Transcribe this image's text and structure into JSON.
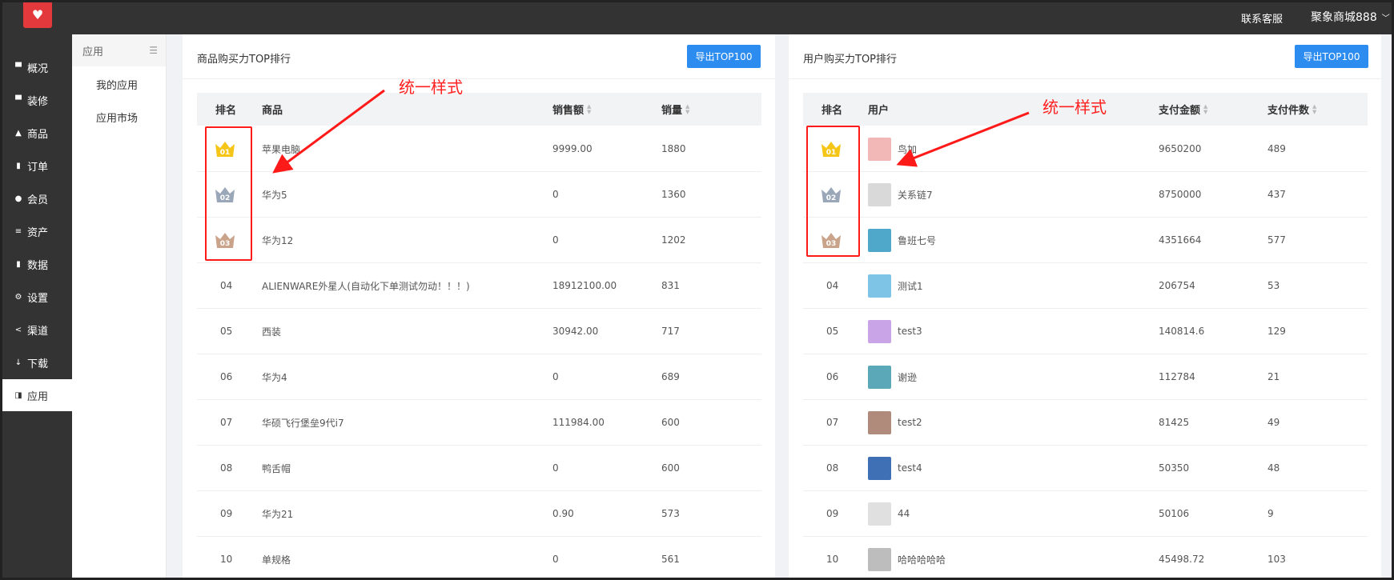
{
  "topbar": {
    "service": "联系客服",
    "shop": "聚象商城888"
  },
  "sidebar": {
    "items": [
      {
        "label": "概况",
        "icon": "monitor-icon"
      },
      {
        "label": "装修",
        "icon": "brush-icon"
      },
      {
        "label": "商品",
        "icon": "bag-icon"
      },
      {
        "label": "订单",
        "icon": "clipboard-icon"
      },
      {
        "label": "会员",
        "icon": "user-icon"
      },
      {
        "label": "资产",
        "icon": "database-icon"
      },
      {
        "label": "数据",
        "icon": "bar-chart-icon"
      },
      {
        "label": "设置",
        "icon": "gear-icon"
      },
      {
        "label": "渠道",
        "icon": "share-icon"
      },
      {
        "label": "下载",
        "icon": "download-icon"
      },
      {
        "label": "应用",
        "icon": "app-icon"
      }
    ]
  },
  "subnav": {
    "title": "应用",
    "items": [
      "我的应用",
      "应用市场"
    ]
  },
  "product_panel": {
    "title": "商品购买力TOP排行",
    "export_label": "导出TOP100",
    "columns": [
      "排名",
      "商品",
      "销售额",
      "销量"
    ],
    "rows": [
      {
        "rank": "01",
        "name": "苹果电脑",
        "sales": "9999.00",
        "qty": "1880"
      },
      {
        "rank": "02",
        "name": "华为5",
        "sales": "0",
        "qty": "1360"
      },
      {
        "rank": "03",
        "name": "华为12",
        "sales": "0",
        "qty": "1202"
      },
      {
        "rank": "04",
        "name": "ALIENWARE外星人(自动化下单测试勿动！！！)",
        "sales": "18912100.00",
        "qty": "831"
      },
      {
        "rank": "05",
        "name": "西装",
        "sales": "30942.00",
        "qty": "717"
      },
      {
        "rank": "06",
        "name": "华为4",
        "sales": "0",
        "qty": "689"
      },
      {
        "rank": "07",
        "name": "华硕飞行堡垒9代i7",
        "sales": "111984.00",
        "qty": "600"
      },
      {
        "rank": "08",
        "name": "鸭舌帽",
        "sales": "0",
        "qty": "600"
      },
      {
        "rank": "09",
        "name": "华为21",
        "sales": "0.90",
        "qty": "573"
      },
      {
        "rank": "10",
        "name": "单规格",
        "sales": "0",
        "qty": "561"
      }
    ]
  },
  "user_panel": {
    "title": "用户购买力TOP排行",
    "export_label": "导出TOP100",
    "columns": [
      "排名",
      "用户",
      "支付金额",
      "支付件数"
    ],
    "rows": [
      {
        "rank": "01",
        "name": "鸟加",
        "amount": "9650200",
        "count": "489",
        "avatar_color": "#f2b8b8"
      },
      {
        "rank": "02",
        "name": "关系链7",
        "amount": "8750000",
        "count": "437",
        "avatar_color": "#d9d9d9"
      },
      {
        "rank": "03",
        "name": "鲁班七号",
        "amount": "4351664",
        "count": "577",
        "avatar_color": "#4fa7c9"
      },
      {
        "rank": "04",
        "name": "测试1",
        "amount": "206754",
        "count": "53",
        "avatar_color": "#7ec4e6"
      },
      {
        "rank": "05",
        "name": "test3",
        "amount": "140814.6",
        "count": "129",
        "avatar_color": "#c9a4e6"
      },
      {
        "rank": "06",
        "name": "谢逊",
        "amount": "112784",
        "count": "21",
        "avatar_color": "#5aa8b8"
      },
      {
        "rank": "07",
        "name": "test2",
        "amount": "81425",
        "count": "49",
        "avatar_color": "#b08a7a"
      },
      {
        "rank": "08",
        "name": "test4",
        "amount": "50350",
        "count": "48",
        "avatar_color": "#3f6fb5"
      },
      {
        "rank": "09",
        "name": "44",
        "amount": "50106",
        "count": "9",
        "avatar_color": "#e0e0e0"
      },
      {
        "rank": "10",
        "name": "哈哈哈哈哈",
        "amount": "45498.72",
        "count": "103",
        "avatar_color": "#bdbdbd"
      }
    ]
  },
  "annotations": {
    "left": "统一样式",
    "right": "统一样式"
  },
  "colors": {
    "gold": "#f5c518",
    "silver": "#9aa7b8",
    "bronze": "#c9a48a",
    "accent": "#2d8cf0",
    "annotation": "#ff1a1a"
  }
}
